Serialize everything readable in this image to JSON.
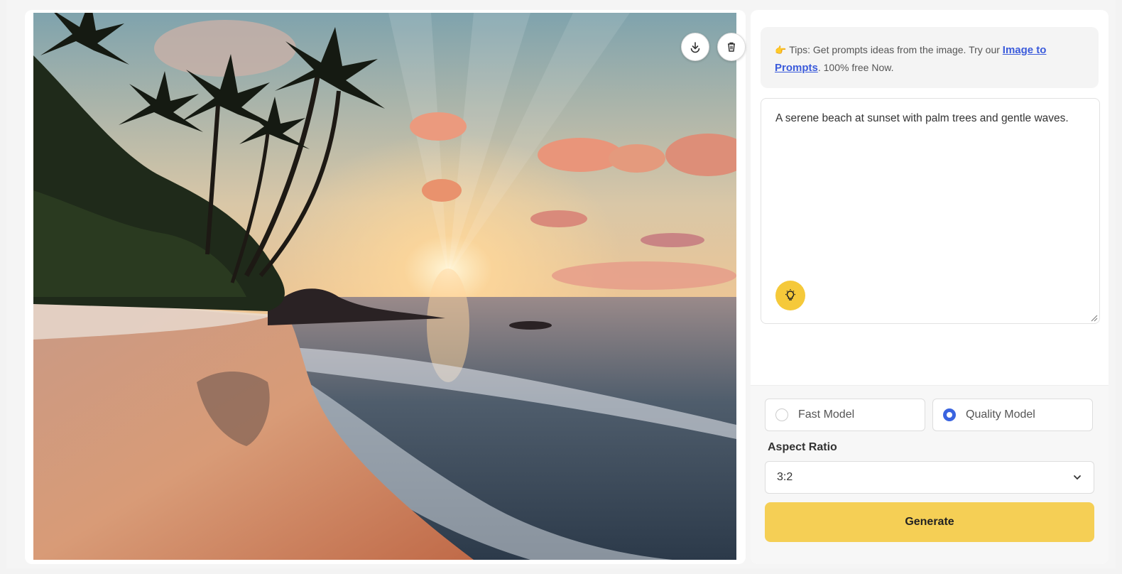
{
  "image_panel": {
    "download_icon": "download-icon",
    "delete_icon": "trash-icon"
  },
  "tips": {
    "prefix": "Tips: Get prompts ideas from the image. Try our",
    "link_text": "Image to Prompts",
    "suffix": ". 100% free Now.",
    "icon": "pointing-hand-icon"
  },
  "prompt": {
    "value": "A serene beach at sunset with palm trees and gentle waves.",
    "idea_icon": "lightbulb-icon"
  },
  "models": {
    "options": [
      {
        "label": "Fast Model",
        "selected": false
      },
      {
        "label": "Quality Model",
        "selected": true
      }
    ]
  },
  "aspect_ratio": {
    "label": "Aspect Ratio",
    "value": "3:2"
  },
  "generate": {
    "label": "Generate"
  },
  "colors": {
    "accent": "#f5cf55",
    "radio_selected": "#3a64e0",
    "link": "#3b5bdb"
  }
}
